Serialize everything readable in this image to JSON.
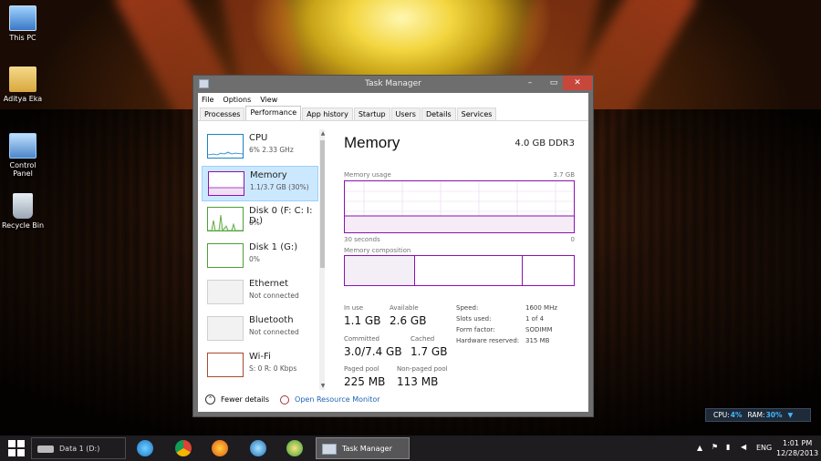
{
  "desktop": {
    "icons": [
      {
        "label": "This PC"
      },
      {
        "label": "Aditya Eka"
      },
      {
        "label": "Control Panel"
      },
      {
        "label": "Recycle Bin"
      }
    ]
  },
  "window": {
    "title": "Task Manager",
    "controls": {
      "minimize": "–",
      "maximize": "▭",
      "close": "✕"
    },
    "menu": [
      "File",
      "Options",
      "View"
    ],
    "tabs": [
      "Processes",
      "Performance",
      "App history",
      "Startup",
      "Users",
      "Details",
      "Services"
    ],
    "active_tab": "Performance",
    "resources": [
      {
        "name": "CPU",
        "sub": "6%  2.33 GHz",
        "color": "#1a82c8"
      },
      {
        "name": "Memory",
        "sub": "1.1/3.7 GB (30%)",
        "color": "#8b12ae"
      },
      {
        "name": "Disk 0 (F: C: I: D:)",
        "sub": "0%",
        "color": "#4da033"
      },
      {
        "name": "Disk 1 (G:)",
        "sub": "0%",
        "color": "#4da033"
      },
      {
        "name": "Ethernet",
        "sub": "Not connected",
        "color": "#b5b5b5"
      },
      {
        "name": "Bluetooth",
        "sub": "Not connected",
        "color": "#b5b5b5"
      },
      {
        "name": "Wi-Fi",
        "sub": "S: 0  R: 0 Kbps",
        "color": "#a7492d"
      }
    ],
    "detail": {
      "title": "Memory",
      "type": "4.0 GB DDR3",
      "usage_label": "Memory usage",
      "usage_max": "3.7 GB",
      "time_label": "30 seconds",
      "time_zero": "0",
      "composition_label": "Memory composition",
      "stats": {
        "in_use_label": "In use",
        "in_use": "1.1 GB",
        "available_label": "Available",
        "available": "2.6 GB",
        "committed_label": "Committed",
        "committed": "3.0/7.4 GB",
        "cached_label": "Cached",
        "cached": "1.7 GB",
        "paged_label": "Paged pool",
        "paged": "225 MB",
        "nonpaged_label": "Non-paged pool",
        "nonpaged": "113 MB"
      },
      "specs": [
        {
          "k": "Speed:",
          "v": "1600 MHz"
        },
        {
          "k": "Slots used:",
          "v": "1 of 4"
        },
        {
          "k": "Form factor:",
          "v": "SODIMM"
        },
        {
          "k": "Hardware reserved:",
          "v": "315 MB"
        }
      ]
    },
    "footer": {
      "fewer": "Fewer details",
      "monitor": "Open Resource Monitor"
    }
  },
  "gadget": {
    "cpu_label": "CPU:",
    "cpu": "4%",
    "ram_label": "RAM:",
    "ram": "30%"
  },
  "taskbar": {
    "drive_label": "Data 1 (D:)",
    "task_label": "Task Manager",
    "lang": "ENG",
    "time": "1:01 PM",
    "date": "12/28/2013"
  }
}
